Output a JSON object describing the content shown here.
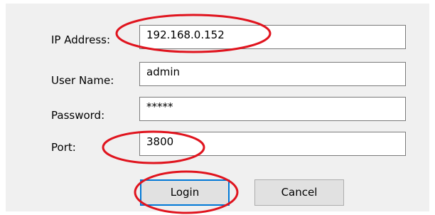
{
  "form": {
    "ip_label": "IP Address:",
    "ip_value": "192.168.0.152",
    "user_label": "User Name:",
    "user_value": "admin",
    "password_label": "Password:",
    "password_value": "*****",
    "port_label": "Port:",
    "port_value": "3800"
  },
  "buttons": {
    "login_label": "Login",
    "cancel_label": "Cancel"
  },
  "colors": {
    "window_background": "#f0f0f0",
    "annotation_circle": "#e0141e",
    "focus_border": "#0078d7"
  }
}
